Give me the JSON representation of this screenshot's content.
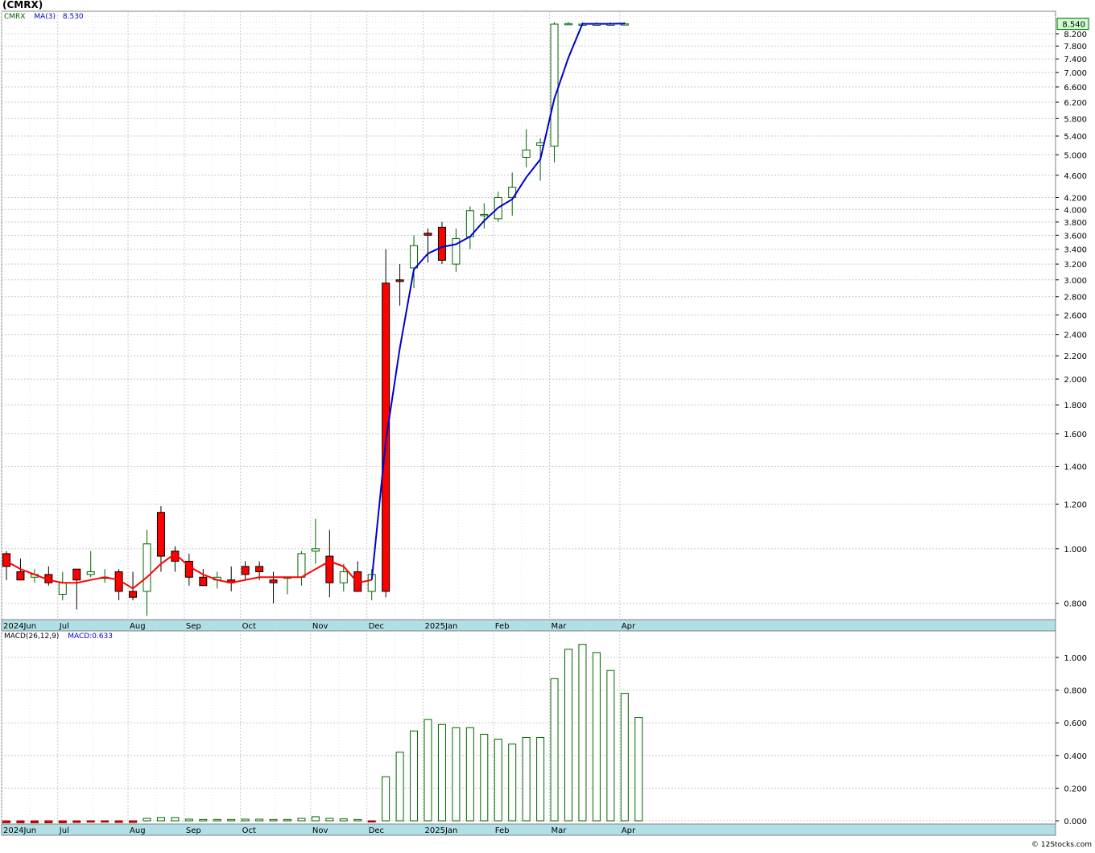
{
  "header": {
    "title": "(CMRX)"
  },
  "price_legend": {
    "symbol": "CMRX",
    "ma_label": "MA(3)",
    "ma_value": "8.530"
  },
  "macd_legend": {
    "label": "MACD(26,12,9)",
    "value_label": "MACD:0.633"
  },
  "last_price_tag": "8.540",
  "credit": "© 12Stocks.com",
  "colors": {
    "up": "#006400",
    "down": "#ff0000",
    "ma_blue": "#0000cc",
    "ma_red": "#ff0000",
    "axis_strip": "#b0e0e6",
    "grid": "#c8c8c8",
    "tag_fill": "#ccffcc"
  },
  "x_axis_labels": [
    "2024Jun",
    "Jul",
    "Aug",
    "Sep",
    "Oct",
    "Nov",
    "Dec",
    "2025Jan",
    "Feb",
    "Mar",
    "Apr"
  ],
  "price_ticks": [
    "0.800",
    "1.000",
    "1.200",
    "1.400",
    "1.600",
    "1.800",
    "2.000",
    "2.200",
    "2.400",
    "2.600",
    "2.800",
    "3.000",
    "3.200",
    "3.400",
    "3.600",
    "3.800",
    "4.000",
    "4.200",
    "4.600",
    "5.000",
    "5.400",
    "5.800",
    "6.200",
    "6.600",
    "7.000",
    "7.400",
    "7.800",
    "8.200"
  ],
  "macd_ticks": [
    "0.000",
    "0.200",
    "0.400",
    "0.600",
    "0.800",
    "1.000"
  ],
  "chart_data": [
    {
      "type": "candlestick",
      "title": "(CMRX)",
      "scale": "log",
      "interval": "weekly",
      "ylim": [
        0.72,
        8.8
      ],
      "grid": true,
      "x": [
        "2024-06-03",
        "2024-06-10",
        "2024-06-17",
        "2024-06-24",
        "2024-07-01",
        "2024-07-08",
        "2024-07-15",
        "2024-07-22",
        "2024-07-29",
        "2024-08-05",
        "2024-08-12",
        "2024-08-19",
        "2024-08-26",
        "2024-09-02",
        "2024-09-09",
        "2024-09-16",
        "2024-09-23",
        "2024-09-30",
        "2024-10-07",
        "2024-10-14",
        "2024-10-21",
        "2024-10-28",
        "2024-11-04",
        "2024-11-11",
        "2024-11-18",
        "2024-11-25",
        "2024-12-02",
        "2024-12-09",
        "2024-12-16",
        "2024-12-23",
        "2024-12-30",
        "2025-01-06",
        "2025-01-13",
        "2025-01-20",
        "2025-01-27",
        "2025-02-03",
        "2025-02-10",
        "2025-02-17",
        "2025-02-24",
        "2025-03-03",
        "2025-03-10",
        "2025-03-17",
        "2025-03-24",
        "2025-03-31",
        "2025-04-07"
      ],
      "open": [
        0.98,
        0.91,
        0.89,
        0.9,
        0.83,
        0.92,
        0.9,
        0.89,
        0.91,
        0.84,
        0.84,
        1.16,
        0.99,
        0.95,
        0.89,
        0.88,
        0.88,
        0.93,
        0.93,
        0.88,
        0.89,
        0.89,
        0.99,
        0.97,
        0.87,
        0.91,
        0.84,
        2.96,
        3.0,
        3.15,
        3.63,
        3.72,
        3.2,
        3.58,
        3.9,
        3.85,
        4.2,
        4.95,
        5.2,
        5.18,
        8.53,
        8.53,
        8.53,
        8.53,
        8.54
      ],
      "high": [
        0.99,
        0.96,
        0.92,
        0.93,
        0.91,
        0.92,
        0.99,
        0.92,
        0.92,
        0.91,
        1.08,
        1.19,
        1.01,
        0.98,
        0.92,
        0.91,
        0.93,
        0.95,
        0.95,
        0.91,
        0.89,
        0.99,
        1.13,
        1.08,
        0.94,
        0.95,
        0.92,
        3.4,
        3.2,
        3.6,
        3.7,
        3.8,
        3.7,
        4.05,
        4.1,
        4.3,
        4.65,
        5.55,
        5.35,
        8.6,
        8.6,
        8.6,
        8.6,
        8.6,
        8.6
      ],
      "low": [
        0.88,
        0.88,
        0.87,
        0.86,
        0.81,
        0.78,
        0.89,
        0.87,
        0.81,
        0.81,
        0.76,
        0.91,
        0.91,
        0.86,
        0.86,
        0.85,
        0.84,
        0.88,
        0.88,
        0.8,
        0.83,
        0.86,
        0.94,
        0.82,
        0.84,
        0.84,
        0.81,
        0.82,
        2.7,
        2.9,
        3.22,
        3.2,
        3.1,
        3.4,
        3.7,
        3.8,
        3.9,
        4.75,
        4.5,
        4.85,
        8.5,
        8.5,
        8.5,
        8.5,
        8.5
      ],
      "close": [
        0.93,
        0.88,
        0.9,
        0.87,
        0.87,
        0.88,
        0.91,
        0.89,
        0.84,
        0.82,
        1.02,
        0.97,
        0.95,
        0.89,
        0.86,
        0.89,
        0.87,
        0.9,
        0.91,
        0.87,
        0.89,
        0.98,
        1.0,
        0.87,
        0.91,
        0.84,
        0.9,
        0.84,
        2.98,
        3.45,
        3.6,
        3.25,
        3.55,
        3.98,
        3.92,
        4.2,
        4.38,
        5.1,
        5.25,
        8.53,
        8.55,
        8.53,
        8.53,
        8.53,
        8.54
      ],
      "series": [
        {
          "name": "MA(3)",
          "values": [
            0.95,
            0.92,
            0.9,
            0.88,
            0.87,
            0.87,
            0.88,
            0.89,
            0.88,
            0.85,
            0.89,
            0.94,
            0.98,
            0.93,
            0.9,
            0.88,
            0.87,
            0.88,
            0.89,
            0.89,
            0.89,
            0.89,
            0.92,
            0.95,
            0.93,
            0.87,
            0.88,
            1.55,
            2.27,
            3.13,
            3.34,
            3.43,
            3.47,
            3.58,
            3.82,
            4.03,
            4.17,
            4.56,
            4.91,
            6.29,
            7.44,
            8.54,
            8.54,
            8.54,
            8.55
          ]
        }
      ]
    },
    {
      "type": "bar",
      "title": "MACD(26,12,9)",
      "x": [
        "2024-06-03",
        "2024-06-10",
        "2024-06-17",
        "2024-06-24",
        "2024-07-01",
        "2024-07-08",
        "2024-07-15",
        "2024-07-22",
        "2024-07-29",
        "2024-08-05",
        "2024-08-12",
        "2024-08-19",
        "2024-08-26",
        "2024-09-02",
        "2024-09-09",
        "2024-09-16",
        "2024-09-23",
        "2024-09-30",
        "2024-10-07",
        "2024-10-14",
        "2024-10-21",
        "2024-10-28",
        "2024-11-04",
        "2024-11-11",
        "2024-11-18",
        "2024-11-25",
        "2024-12-02",
        "2024-12-09",
        "2024-12-16",
        "2024-12-23",
        "2024-12-30",
        "2025-01-06",
        "2025-01-13",
        "2025-01-20",
        "2025-01-27",
        "2025-02-03",
        "2025-02-10",
        "2025-02-17",
        "2025-02-24",
        "2025-03-03",
        "2025-03-10",
        "2025-03-17",
        "2025-03-24",
        "2025-03-31",
        "2025-04-07"
      ],
      "values": [
        -0.012,
        -0.012,
        -0.012,
        -0.012,
        -0.012,
        -0.01,
        -0.008,
        -0.008,
        -0.01,
        -0.01,
        0.015,
        0.02,
        0.02,
        0.01,
        0.008,
        0.008,
        0.008,
        0.01,
        0.01,
        0.008,
        0.008,
        0.015,
        0.025,
        0.015,
        0.012,
        0.008,
        -0.005,
        0.27,
        0.42,
        0.55,
        0.62,
        0.59,
        0.57,
        0.57,
        0.53,
        0.5,
        0.47,
        0.51,
        0.51,
        0.87,
        1.05,
        1.08,
        1.03,
        0.92,
        0.78,
        0.633
      ],
      "ylim": [
        -0.02,
        1.12
      ],
      "grid": true
    }
  ]
}
